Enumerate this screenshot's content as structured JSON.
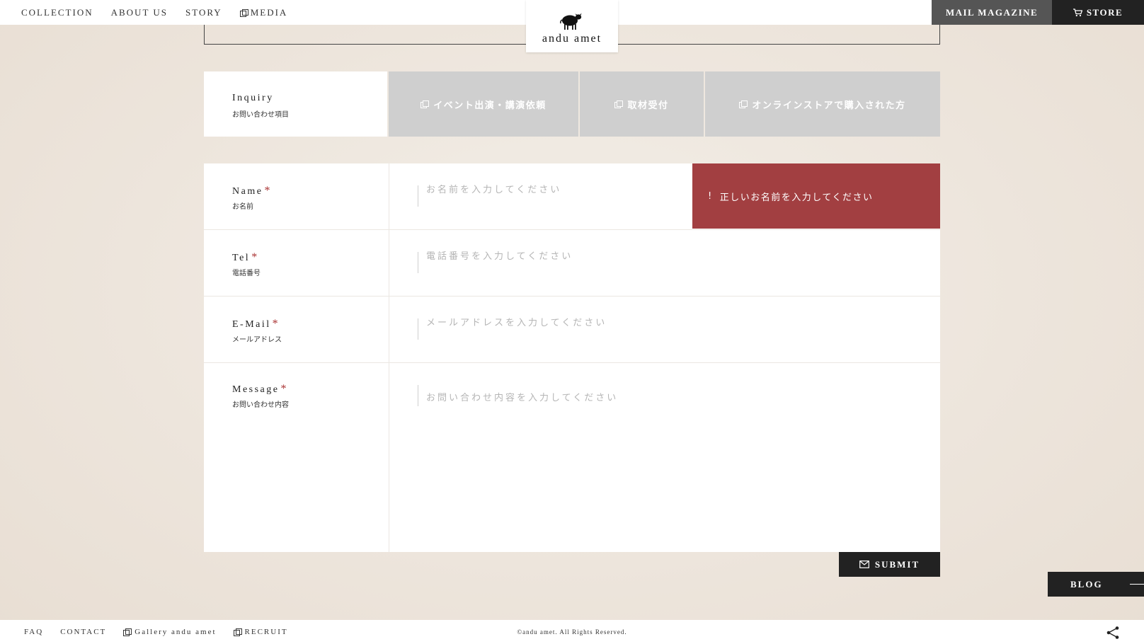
{
  "header": {
    "nav": [
      {
        "label": "COLLECTION",
        "icon": ""
      },
      {
        "label": "ABOUT US",
        "icon": ""
      },
      {
        "label": "STORY",
        "icon": ""
      },
      {
        "label": "MEDIA",
        "icon": "external-link-icon"
      }
    ],
    "logo_text": "andu amet",
    "mail_magazine": "MAIL MAGAZINE",
    "store": "STORE"
  },
  "inquiry": {
    "label_en": "Inquiry",
    "label_jp": "お問い合わせ項目",
    "tabs": [
      {
        "label": "イベント出演・講演依頼"
      },
      {
        "label": "取材受付"
      },
      {
        "label": "オンラインストアで購入された方"
      }
    ]
  },
  "form": {
    "name": {
      "label_en": "Name",
      "label_jp": "お名前",
      "placeholder": "お名前を入力してください",
      "value": ""
    },
    "tel": {
      "label_en": "Tel",
      "label_jp": "電話番号",
      "placeholder": "電話番号を入力してください",
      "value": ""
    },
    "email": {
      "label_en": "E-Mail",
      "label_jp": "メールアドレス",
      "placeholder": "メールアドレスを入力してください",
      "value": ""
    },
    "message": {
      "label_en": "Message",
      "label_jp": "お問い合わせ内容",
      "placeholder": "お問い合わせ内容を入力してください",
      "value": ""
    },
    "required_mark": "*",
    "error_icon": "!",
    "error_name": "正しいお名前を入力してください"
  },
  "submit": "SUBMIT",
  "blog": "BLOG",
  "footer": {
    "links": [
      "FAQ",
      "CONTACT",
      "Gallery andu amet",
      "RECRUIT"
    ],
    "copyright": "©andu amet. All Rights Reserved."
  },
  "colors": {
    "error": "#a23f41",
    "dark": "#222222",
    "tab_inactive": "#cfcfcf"
  }
}
